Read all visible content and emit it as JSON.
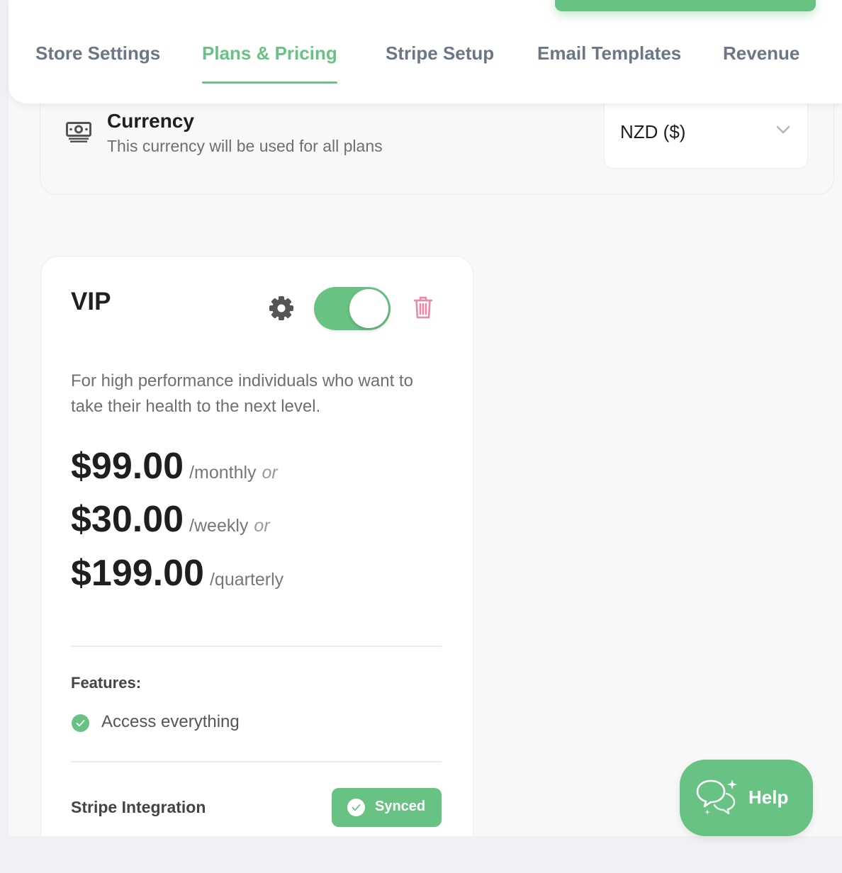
{
  "tabs": [
    {
      "label": "Store Settings",
      "active": false
    },
    {
      "label": "Plans & Pricing",
      "active": true
    },
    {
      "label": "Stripe Setup",
      "active": false
    },
    {
      "label": "Email Templates",
      "active": false
    },
    {
      "label": "Revenue",
      "active": false
    }
  ],
  "currency": {
    "title": "Currency",
    "subtitle": "This currency will be used for all plans",
    "selected": "NZD ($)",
    "icon": "money-icon"
  },
  "plan": {
    "name": "VIP",
    "enabled": true,
    "description": "For high performance individuals who want to take their health to the next level.",
    "prices": [
      {
        "amount": "$99.00",
        "period": "/monthly",
        "or": "or"
      },
      {
        "amount": "$30.00",
        "period": "/weekly",
        "or": "or"
      },
      {
        "amount": "$199.00",
        "period": "/quarterly",
        "or": ""
      }
    ],
    "features_label": "Features:",
    "features": [
      "Access everything"
    ],
    "stripe_label": "Stripe Integration",
    "stripe_status": "Synced"
  },
  "help": {
    "label": "Help"
  },
  "colors": {
    "accent": "#68c283",
    "tab_inactive": "#6b7787",
    "trash": "#e88aa6"
  }
}
